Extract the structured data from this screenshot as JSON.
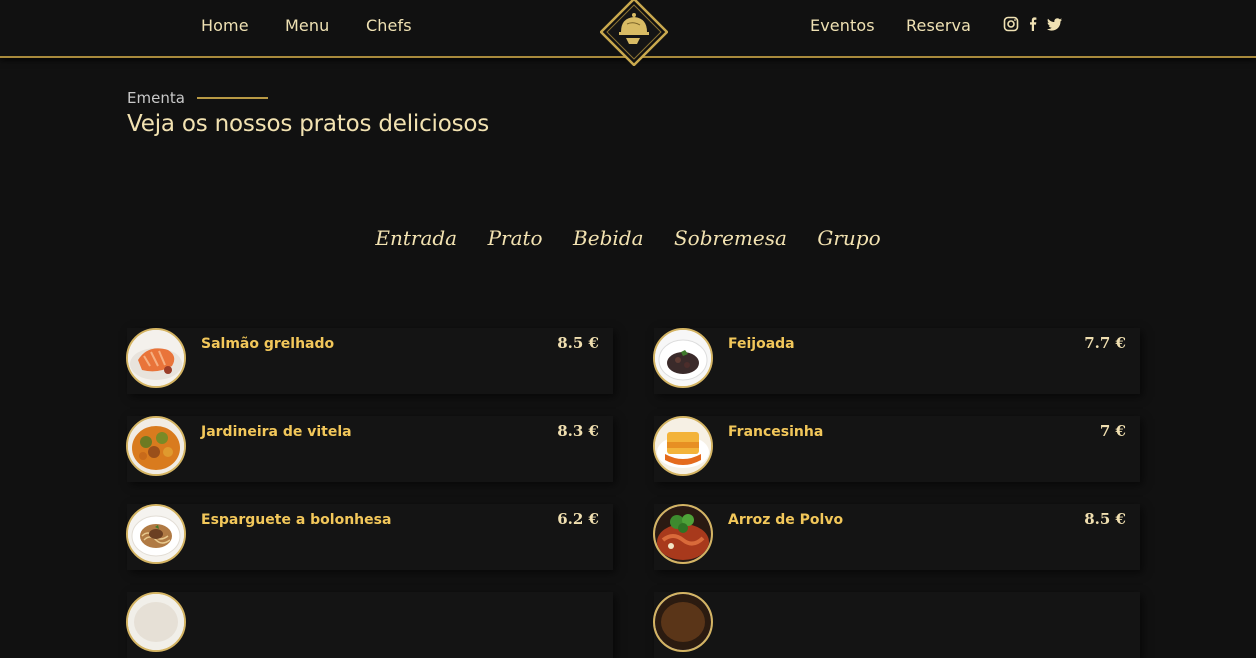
{
  "nav": {
    "home": "Home",
    "menu": "Menu",
    "chefs": "Chefs",
    "events": "Eventos",
    "reservation": "Reserva",
    "logo_icon": "cloche-icon",
    "social": [
      "instagram-icon",
      "facebook-icon",
      "twitter-icon"
    ]
  },
  "section": {
    "eyebrow": "Ementa",
    "title": "Veja os nossos pratos deliciosos"
  },
  "filters": [
    "Entrada",
    "Prato",
    "Bebida",
    "Sobremesa",
    "Grupo"
  ],
  "menu_items": [
    {
      "name": "Salmão grelhado",
      "price": "8.5 €"
    },
    {
      "name": "Feijoada",
      "price": "7.7 €"
    },
    {
      "name": "Jardineira de vitela",
      "price": "8.3 €"
    },
    {
      "name": "Francesinha",
      "price": "7 €"
    },
    {
      "name": "Esparguete a bolonhesa",
      "price": "6.2 €"
    },
    {
      "name": "Arroz de Polvo",
      "price": "8.5 €"
    }
  ],
  "colors": {
    "background": "#111111",
    "gold": "#b99a45",
    "item_name": "#f2c75a",
    "text_light": "#f2e2b1"
  }
}
